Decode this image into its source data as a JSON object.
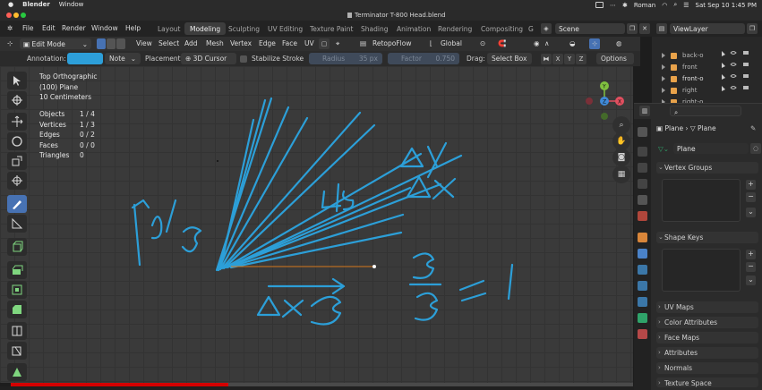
{
  "mac_bar": {
    "app": "Blender",
    "window_menu": "Window",
    "input_source": "Roman",
    "datetime": "Sat Sep 10  1:45 PM"
  },
  "window": {
    "title": "Terminator T-800 Head.blend"
  },
  "menus": [
    "File",
    "Edit",
    "Render",
    "Window",
    "Help"
  ],
  "workspace_tabs": [
    "Layout",
    "Modeling",
    "Sculpting",
    "UV Editing",
    "Texture Paint",
    "Shading",
    "Animation",
    "Rendering",
    "Compositing",
    "G"
  ],
  "active_workspace": "Modeling",
  "scene": {
    "name": "Scene",
    "view_layer": "ViewLayer"
  },
  "header": {
    "mode": "Edit Mode",
    "items": [
      "View",
      "Select",
      "Add",
      "Mesh",
      "Vertex",
      "Edge",
      "Face",
      "UV"
    ],
    "addon": "RetopoFlow",
    "transform_orientation": "Global"
  },
  "tool_settings": {
    "annotation_label": "Annotation:",
    "annotation_color": "#2d9fd9",
    "note": "Note",
    "placement_label": "Placement:",
    "placement": "3D Cursor",
    "stabilize": "Stabilize Stroke",
    "radius_label": "Radius",
    "radius_value": "35 px",
    "factor_label": "Factor",
    "factor_value": "0.750",
    "drag_label": "Drag:",
    "drag_value": "Select Box",
    "axes": [
      "X",
      "Y",
      "Z"
    ],
    "options": "Options"
  },
  "viewport": {
    "view_name": "Top Orthographic",
    "object_name": "(100) Plane",
    "scale": "10 Centimeters",
    "stats": [
      {
        "label": "Objects",
        "value": "1 / 4"
      },
      {
        "label": "Vertices",
        "value": "1 / 3"
      },
      {
        "label": "Edges",
        "value": "0 / 2"
      },
      {
        "label": "Faces",
        "value": "0 / 0"
      },
      {
        "label": "Triangles",
        "value": "0"
      }
    ],
    "gizmo_axes": [
      "X",
      "Y",
      "Z"
    ]
  },
  "progress": {
    "played_fraction": 0.35
  },
  "outliner": {
    "items": [
      "back-o",
      "front",
      "front-o",
      "right",
      "right-o"
    ]
  },
  "properties": {
    "breadcrumb": [
      "Plane",
      "Plane"
    ],
    "data_name": "Plane",
    "panels": [
      "Vertex Groups",
      "Shape Keys",
      "UV Maps",
      "Color Attributes",
      "Face Maps",
      "Attributes",
      "Normals",
      "Texture Space"
    ]
  }
}
